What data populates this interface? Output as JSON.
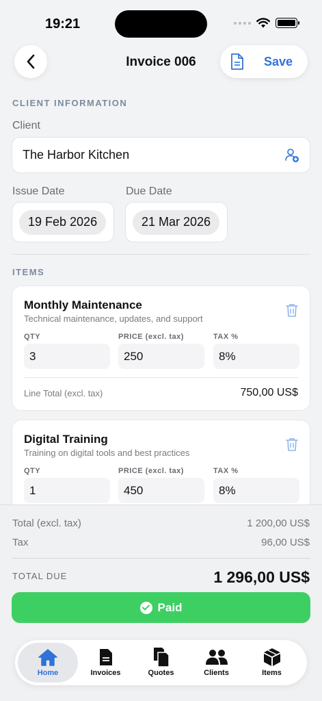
{
  "status": {
    "time": "19:21"
  },
  "nav": {
    "title": "Invoice 006",
    "save_label": "Save"
  },
  "client_section": {
    "heading": "CLIENT INFORMATION",
    "client_label": "Client",
    "client_value": "The Harbor Kitchen",
    "issue_label": "Issue Date",
    "issue_value": "19 Feb 2026",
    "due_label": "Due Date",
    "due_value": "21 Mar 2026"
  },
  "items_section": {
    "heading": "ITEMS",
    "qty_label": "QTY",
    "price_label": "PRICE (excl. tax)",
    "tax_label": "TAX %",
    "line_total_label": "Line Total (excl. tax)",
    "items": [
      {
        "name": "Monthly Maintenance",
        "description": "Technical maintenance, updates, and support",
        "qty": "3",
        "price": "250",
        "tax": "8%",
        "line_total": "750,00 US$"
      },
      {
        "name": "Digital Training",
        "description": "Training on digital tools and best practices",
        "qty": "1",
        "price": "450",
        "tax": "8%"
      }
    ]
  },
  "summary": {
    "subtotal_label": "Total (excl. tax)",
    "subtotal_value": "1 200,00 US$",
    "tax_label": "Tax",
    "tax_value": "96,00 US$",
    "total_label": "TOTAL DUE",
    "total_value": "1 296,00 US$",
    "paid_label": "Paid"
  },
  "tabbar": {
    "tabs": [
      {
        "label": "Home",
        "icon": "home-icon",
        "active": true
      },
      {
        "label": "Invoices",
        "icon": "invoice-icon"
      },
      {
        "label": "Quotes",
        "icon": "quotes-icon"
      },
      {
        "label": "Clients",
        "icon": "clients-icon"
      },
      {
        "label": "Items",
        "icon": "box-icon"
      }
    ]
  },
  "colors": {
    "accent": "#2f73d9",
    "paid": "#3ecf63",
    "background": "#f2f3f5"
  }
}
